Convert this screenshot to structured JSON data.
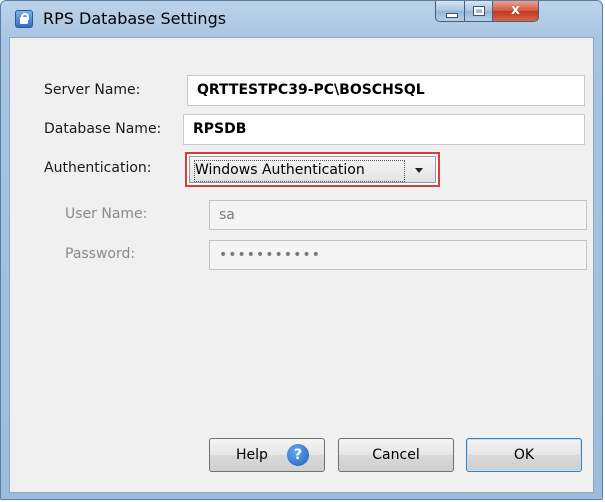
{
  "window": {
    "title": "RPS Database Settings",
    "close_glyph": "x"
  },
  "form": {
    "server_label": "Server Name:",
    "server_value": "QRTTESTPC39-PC\\BOSCHSQL",
    "database_label": "Database Name:",
    "database_value": "RPSDB",
    "auth_label": "Authentication:",
    "auth_value": "Windows Authentication",
    "user_label": "User Name:",
    "user_value": "sa",
    "password_label": "Password:",
    "password_value": "•••••••••••"
  },
  "buttons": {
    "help_label": "Help",
    "help_icon_glyph": "?",
    "cancel_label": "Cancel",
    "ok_label": "OK"
  },
  "icons": {
    "app": "lock-icon",
    "help": "question-icon",
    "dropdown": "chevron-down-icon"
  },
  "colors": {
    "focus_highlight": "#d63d3d",
    "close_button": "#c4361b"
  }
}
